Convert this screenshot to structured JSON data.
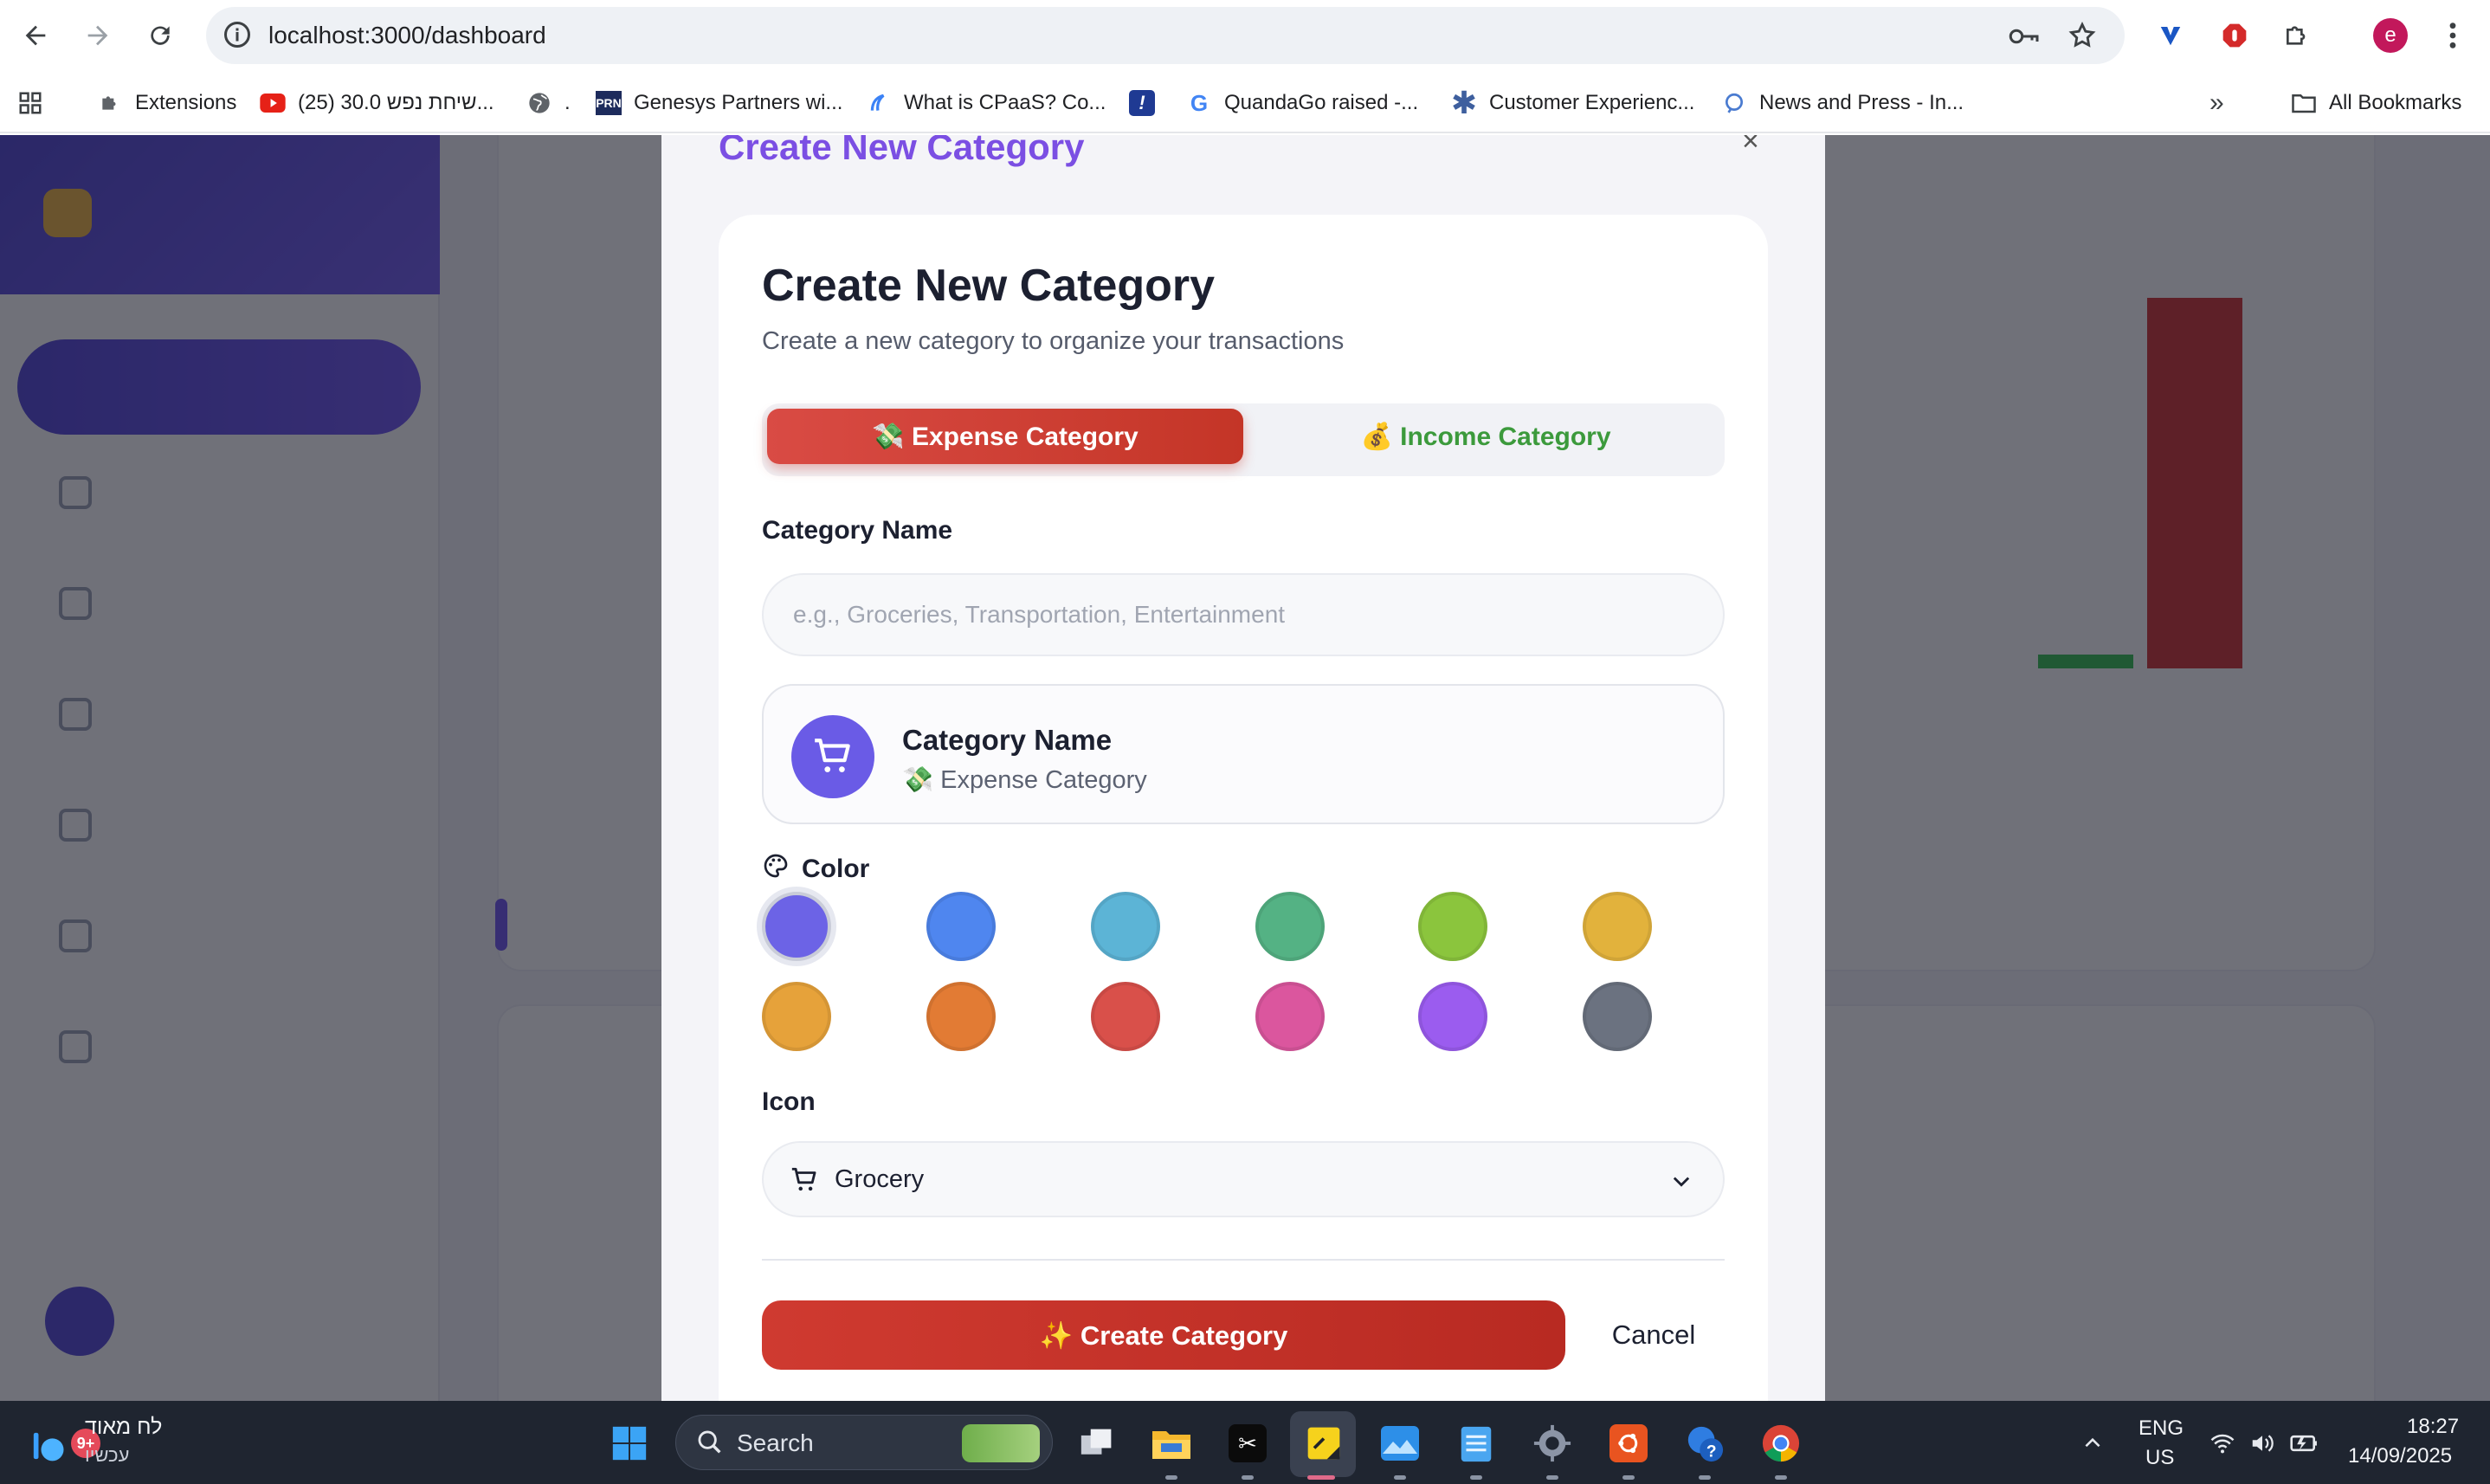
{
  "browser": {
    "url": "localhost:3000/dashboard",
    "bookmarks": [
      "Extensions",
      "(25) שיחת נפש 30.0...",
      ".",
      "Genesys Partners wi...",
      "What is CPaaS? Co...",
      "QuandaGo raised -...",
      "Customer Experienc...",
      "News and Press - In..."
    ],
    "all_bookmarks": "All Bookmarks",
    "profile_initial": "e"
  },
  "modal": {
    "header_title": "Create New Category",
    "close_glyph": "×",
    "title": "Create New Category",
    "subtitle": "Create a new category to organize your transactions",
    "type_tabs": {
      "expense_label": "💸 Expense Category",
      "income_label": "💰 Income Category",
      "selected": "expense"
    },
    "name_label": "Category Name",
    "name_value": "",
    "name_placeholder": "e.g., Groceries, Transportation, Entertainment",
    "preview": {
      "name": "Category Name",
      "type": "💸 Expense Category",
      "icon": "shopping-cart-icon",
      "color": "#6C63E6"
    },
    "color_label": "Color",
    "colors": [
      "#6C63E6",
      "#4F86EF",
      "#5CB4D6",
      "#54B284",
      "#8BC53D",
      "#E2B23C",
      "#E6A23A",
      "#E27B34",
      "#D9504A",
      "#DB569E",
      "#9B5CEF",
      "#6B7280"
    ],
    "selected_color_index": 0,
    "icon_label": "Icon",
    "icon_value": "Grocery",
    "create_button": "✨ Create Category",
    "cancel_button": "Cancel"
  },
  "taskbar": {
    "weather_text": "לח מאוד",
    "weather_sub": "עכשיו",
    "weather_badge": "9+",
    "search_label": "Search",
    "lang_top": "ENG",
    "lang_bottom": "US",
    "time": "18:27",
    "date": "14/09/2025"
  },
  "colors": {
    "accent": "#7B4FE3",
    "expense": "#C43527",
    "income": "#3C9A3C"
  }
}
